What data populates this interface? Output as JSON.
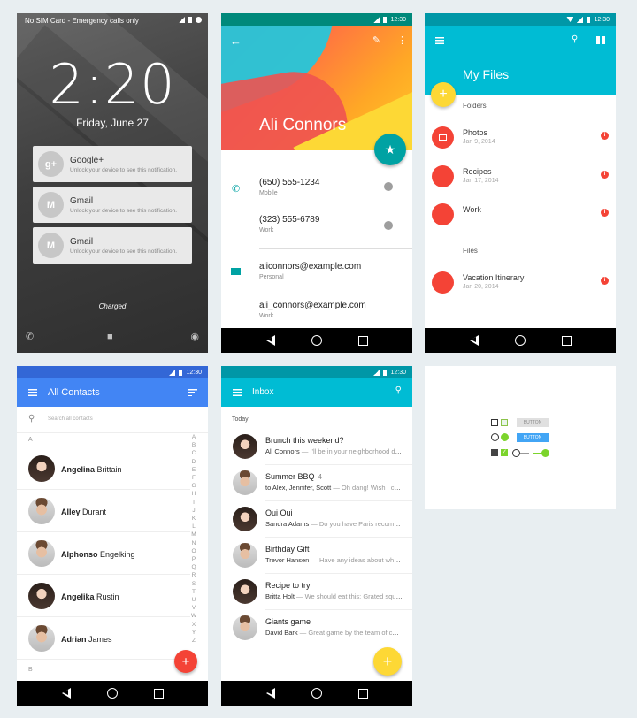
{
  "lockscreen": {
    "carrier": "No SIM Card - Emergency calls only",
    "time": "2:20",
    "date": "Friday, June 27",
    "notifications": [
      {
        "app": "Google+",
        "icon": "g+",
        "text": "Unlock your device to see this notification."
      },
      {
        "app": "Gmail",
        "icon": "M",
        "text": "Unlock your device to see this notification."
      },
      {
        "app": "Gmail",
        "icon": "M",
        "text": "Unlock your device to see this notification."
      }
    ],
    "status": "Charged"
  },
  "contact": {
    "clock": "12:30",
    "name": "Ali Connors",
    "phones": [
      {
        "value": "(650) 555-1234",
        "label": "Mobile"
      },
      {
        "value": "(323) 555-6789",
        "label": "Work"
      }
    ],
    "emails": [
      {
        "value": "aliconnors@example.com",
        "label": "Personal"
      },
      {
        "value": "ali_connors@example.com",
        "label": "Work"
      }
    ]
  },
  "files": {
    "clock": "12:30",
    "title": "My Files",
    "folders_label": "Folders",
    "folders": [
      {
        "name": "Photos",
        "date": "Jan 9, 2014"
      },
      {
        "name": "Recipes",
        "date": "Jan 17, 2014"
      },
      {
        "name": "Work",
        "date": ""
      }
    ],
    "files_label": "Files",
    "files": [
      {
        "name": "Vacation Itinerary",
        "date": "Jan 20, 2014"
      }
    ]
  },
  "contacts": {
    "clock": "12:30",
    "title": "All Contacts",
    "search_placeholder": "Search all contacts",
    "section_a": "A",
    "section_b": "B",
    "people": [
      {
        "first": "Angelina",
        "last": "Brittain",
        "avatar": "w"
      },
      {
        "first": "Alley",
        "last": "Durant",
        "avatar": "m"
      },
      {
        "first": "Alphonso",
        "last": "Engelking",
        "avatar": "m"
      },
      {
        "first": "Angelika",
        "last": "Rustin",
        "avatar": "w"
      },
      {
        "first": "Adrian",
        "last": "James",
        "avatar": "m"
      }
    ],
    "alphabet": [
      "A",
      "B",
      "C",
      "D",
      "E",
      "F",
      "G",
      "H",
      "I",
      "J",
      "K",
      "L",
      "M",
      "N",
      "O",
      "P",
      "Q",
      "R",
      "S",
      "T",
      "U",
      "V",
      "W",
      "X",
      "Y",
      "Z"
    ]
  },
  "inbox": {
    "clock": "12:30",
    "title": "Inbox",
    "today_label": "Today",
    "messages": [
      {
        "subject": "Brunch this weekend?",
        "count": "",
        "sender": "Ali Connors",
        "snippet": "— I'll be in your neighborhood doing errands",
        "avatar": "w"
      },
      {
        "subject": "Summer BBQ",
        "count": "4",
        "sender": "to Alex, Jennifer, Scott",
        "snippet": "— Oh dang! Wish I could make it",
        "avatar": "m"
      },
      {
        "subject": "Oui Oui",
        "count": "",
        "sender": "Sandra Adams",
        "snippet": "— Do you have Paris recommendations",
        "avatar": "w"
      },
      {
        "subject": "Birthday Gift",
        "count": "",
        "sender": "Trevor Hansen",
        "snippet": "— Have any ideas about what we should get",
        "avatar": "m"
      },
      {
        "subject": "Recipe to try",
        "count": "",
        "sender": "Britta Holt",
        "snippet": "— We should eat this: Grated squash",
        "avatar": "w"
      },
      {
        "subject": "Giants game",
        "count": "",
        "sender": "David Bark",
        "snippet": "— Great game by the team of course",
        "avatar": "m"
      }
    ]
  },
  "controls": {
    "button_flat": "BUTTON",
    "button_raised": "BUTTON",
    "accent": "#7cd42c"
  }
}
